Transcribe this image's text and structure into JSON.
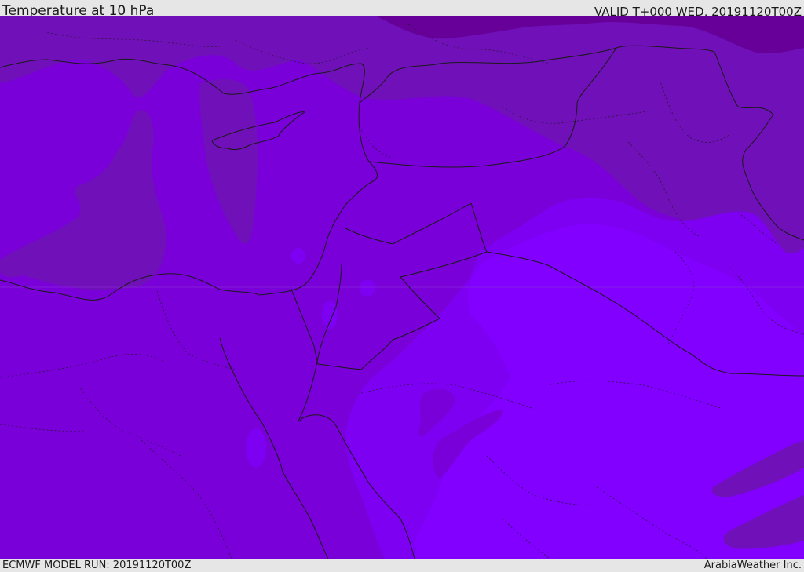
{
  "header": {
    "title": "Temperature at 10 hPa",
    "valid": "VALID T+000 WED, 20191120T00Z"
  },
  "footer": {
    "model_run": "ECMWF MODEL RUN: 20191120T00Z",
    "credit": "ArabiaWeather Inc."
  },
  "colors": {
    "band_coldest": "#660099",
    "band_cold": "#7010b8",
    "band_mid": "#7a00d9",
    "band_warm": "#7e00f2",
    "band_warmest": "#8200ff",
    "coastline": "#1a1a1a",
    "chrome": "#e6e6e6"
  }
}
